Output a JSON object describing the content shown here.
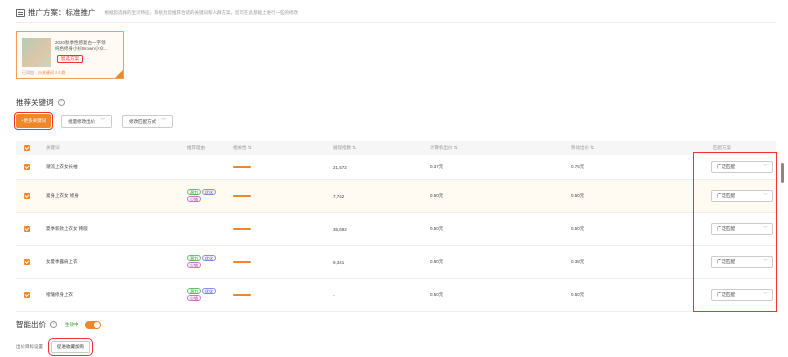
{
  "header": {
    "title": "推广方案：标准推广",
    "desc": "根据您选择的宝贝特征，系统为您推荐合适的关键词和人群方案，您可在此基础上进行一些的修改"
  },
  "plan_card": {
    "line1": "2020秋季性感复古一字领",
    "line2": "纯色修身小衫Brown小众...",
    "tag": "智选方案",
    "stats_prefix": "已添加",
    "stats_value": "20关键词 2人群"
  },
  "section": {
    "title": "推荐关键词",
    "help": "?"
  },
  "toolbar": {
    "add_label": "+更多关键词",
    "bid_label": "批量修改出价",
    "match_label": "修改匹配方式"
  },
  "columns": [
    "关键词",
    "推荐理由",
    "相关性 ⇅",
    "展现指数 ⇅",
    "计算机出价 ⇅",
    "移动出价 ⇅",
    "匹配方案"
  ],
  "rows": [
    {
      "keyword": "潮流上衣女长袖",
      "reasons": [],
      "impressions": "21,572",
      "pc_bid": "0.37元",
      "mobile_bid": "0.75元",
      "match": "广泛匹配"
    },
    {
      "keyword": "紧身上衣女 修身",
      "reasons": [
        [
          "潜力",
          "g"
        ],
        [
          "优化",
          "b"
        ],
        [
          "少销",
          "p"
        ]
      ],
      "impressions": "7,742",
      "pc_bid": "0.50元",
      "mobile_bid": "0.50元",
      "match": "广泛匹配"
    },
    {
      "keyword": "夏季新款上衣女 韩版",
      "reasons": [],
      "impressions": "35,692",
      "pc_bid": "0.50元",
      "mobile_bid": "0.50元",
      "match": "广泛匹配"
    },
    {
      "keyword": "女夏季露肩上衣",
      "reasons": [
        [
          "潜力",
          "g"
        ],
        [
          "优化",
          "b"
        ],
        [
          "少销",
          "p"
        ]
      ],
      "impressions": "9,341",
      "pc_bid": "0.50元",
      "mobile_bid": "0.38元",
      "match": "广泛匹配"
    },
    {
      "keyword": "褶皱修身上衣",
      "reasons": [
        [
          "潜力",
          "g"
        ],
        [
          "优化",
          "b"
        ],
        [
          "少销",
          "p"
        ]
      ],
      "impressions": "-",
      "pc_bid": "0.50元",
      "mobile_bid": "0.50元",
      "match": "广泛匹配"
    }
  ],
  "smart_bid": {
    "title": "智能出价",
    "help": "?",
    "status": "生效中"
  },
  "bid_target": {
    "label": "出价目标设置",
    "value": "促进收藏加购"
  },
  "colors": {
    "accent": "#f0882a",
    "highlight": "#e33333"
  }
}
